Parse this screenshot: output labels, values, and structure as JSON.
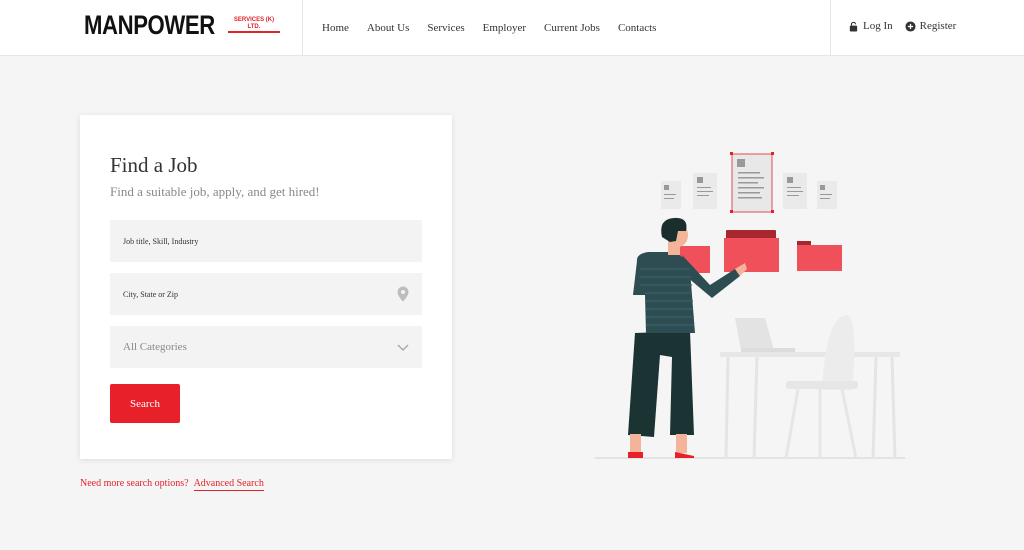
{
  "brand": {
    "name": "MANPOWER",
    "tagline": "SERVICES (K) LTD.",
    "accent_color": "#e1232b"
  },
  "nav": {
    "items": [
      "Home",
      "About Us",
      "Services",
      "Employer",
      "Current Jobs",
      "Contacts"
    ]
  },
  "account": {
    "login_label": "Log In",
    "login_icon": "lock-icon",
    "register_label": "Register",
    "register_icon": "plus-circle-icon"
  },
  "search_card": {
    "title": "Find a Job",
    "subtitle": "Find a suitable job, apply, and get hired!",
    "keyword_placeholder": "Job title, Skill, Industry",
    "location_placeholder": "City, State or Zip",
    "location_icon": "map-pin-icon",
    "category_selected": "All Categories",
    "category_icon": "chevron-down-icon",
    "search_label": "Search",
    "button_color": "#e8202a"
  },
  "more_options": {
    "prompt": "Need more search options?",
    "link": "Advanced Search"
  }
}
